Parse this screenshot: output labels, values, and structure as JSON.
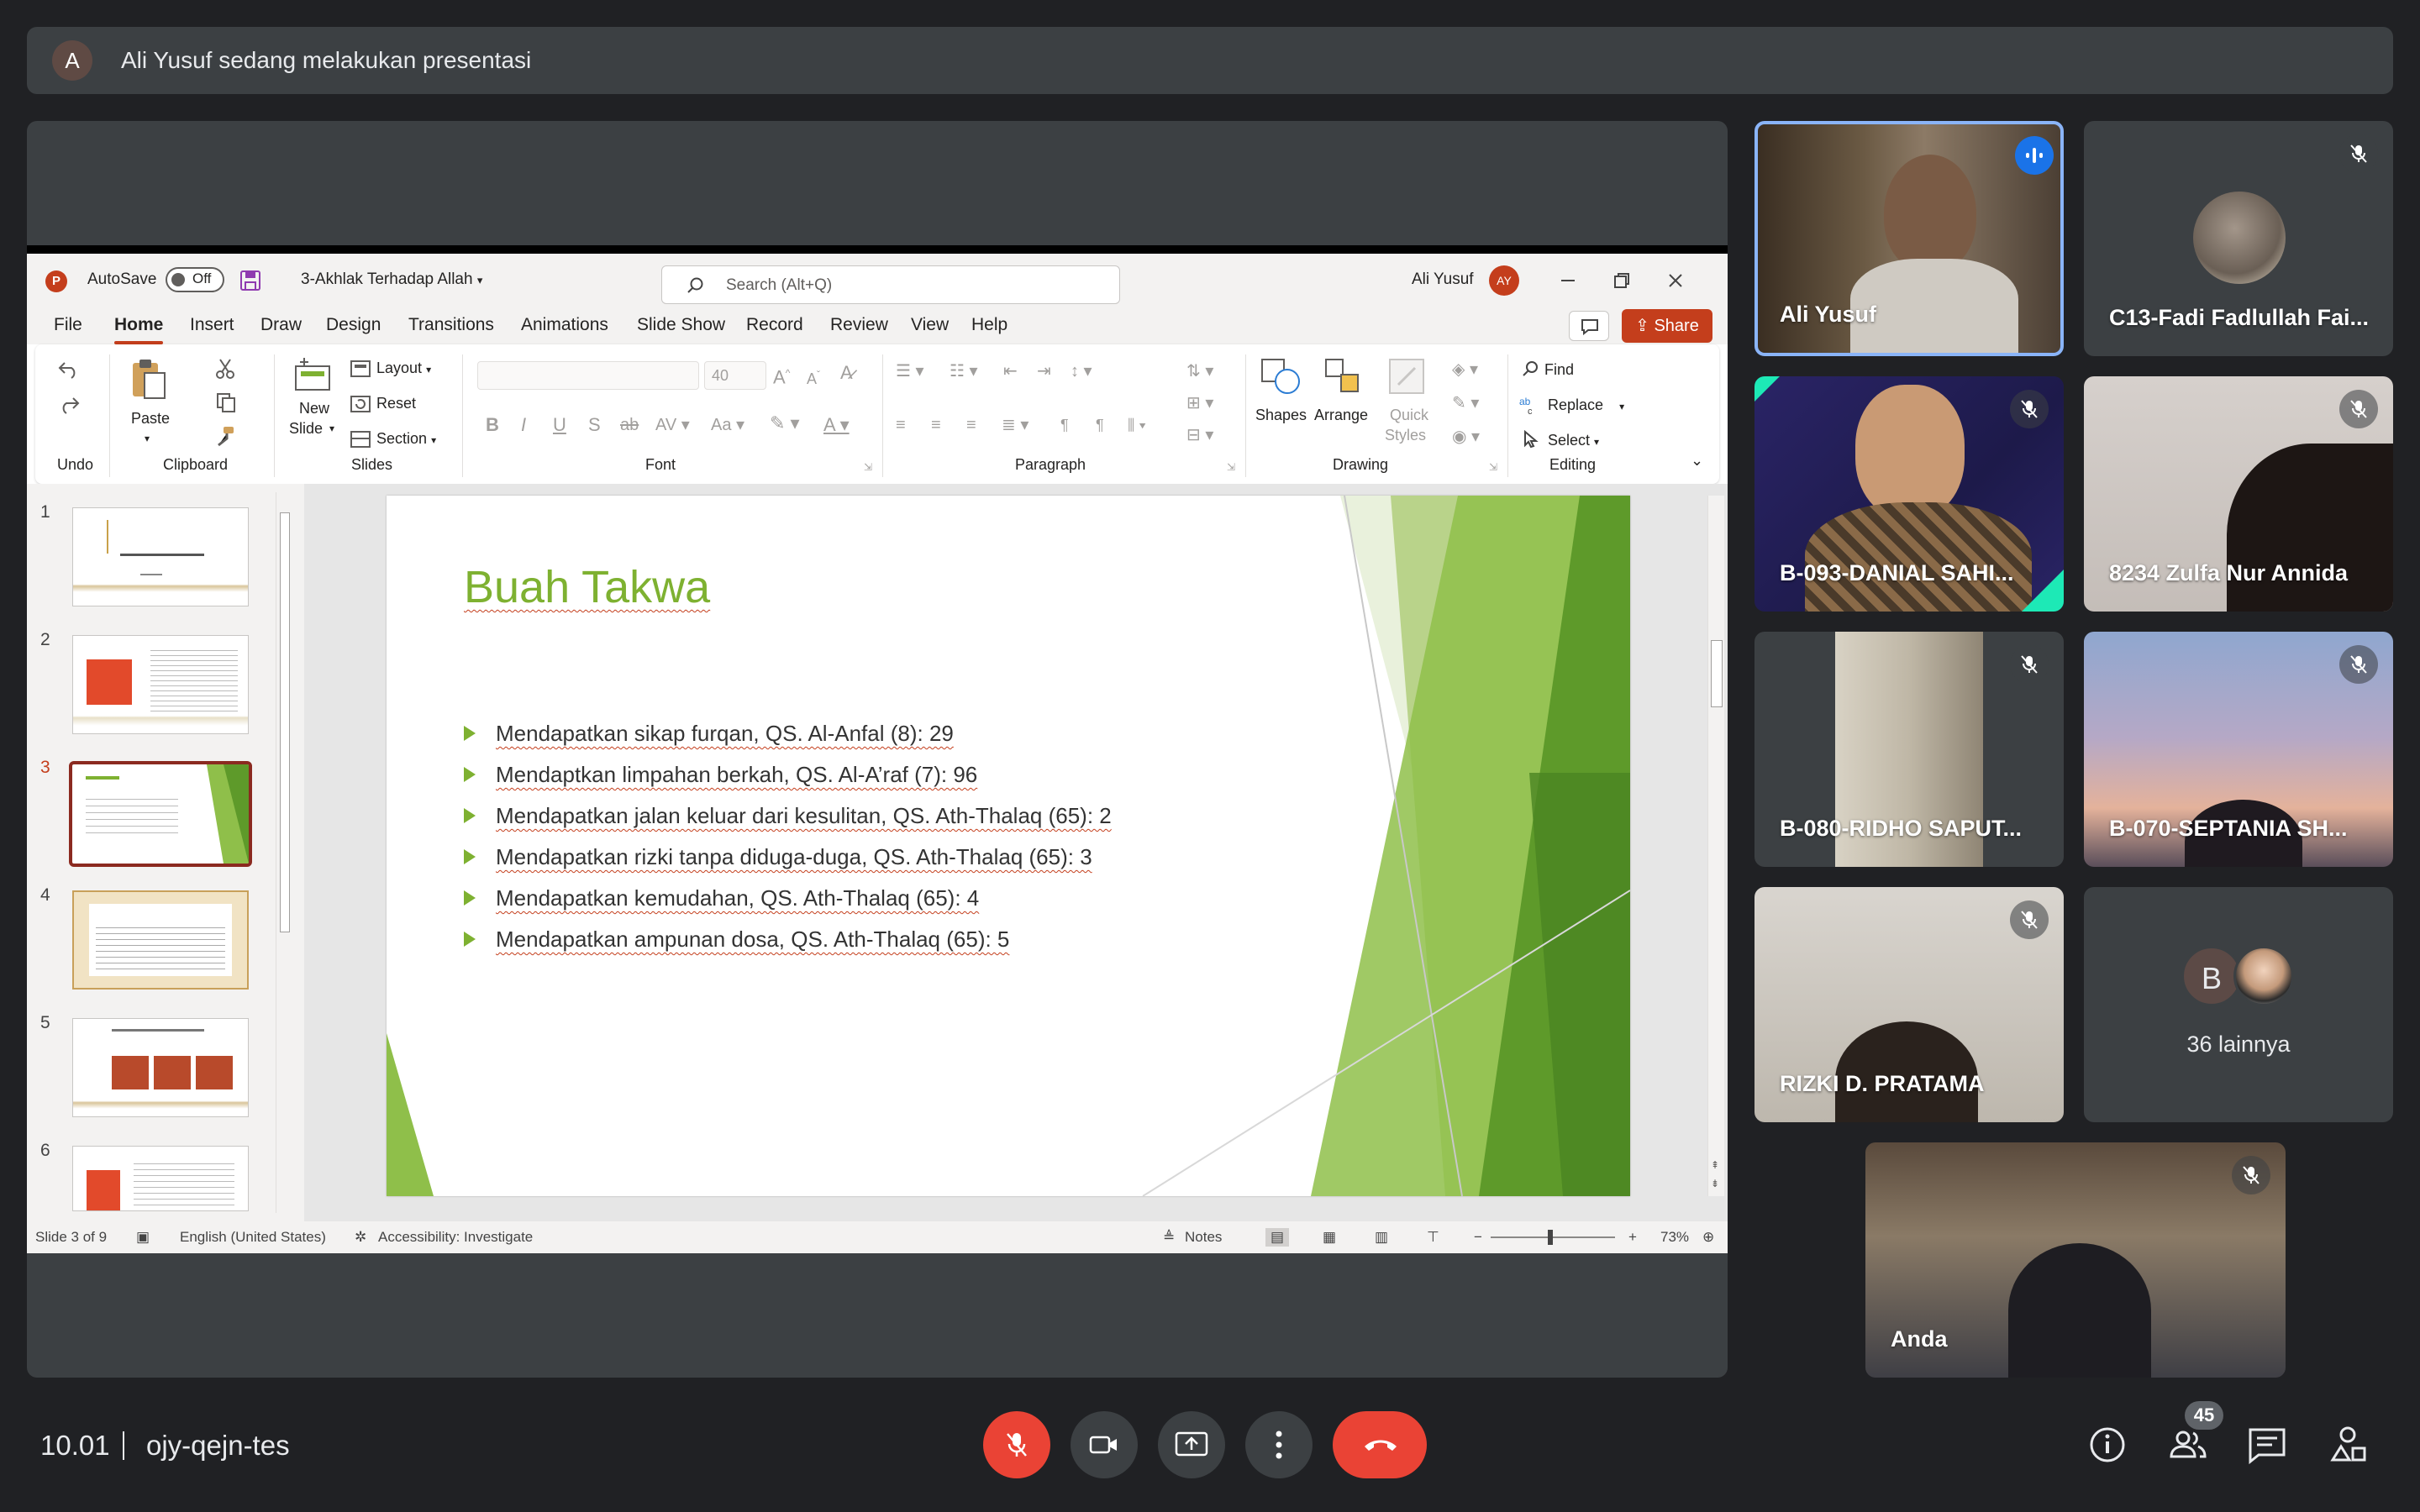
{
  "banner": {
    "avatar_letter": "A",
    "text": "Ali Yusuf sedang melakukan presentasi"
  },
  "ppt": {
    "autosave_label": "AutoSave",
    "autosave_state": "Off",
    "file_name": "3-Akhlak Terhadap Allah",
    "search_placeholder": "Search (Alt+Q)",
    "user_name": "Ali Yusuf",
    "user_initials": "AY",
    "tabs": [
      "File",
      "Home",
      "Insert",
      "Draw",
      "Design",
      "Transitions",
      "Animations",
      "Slide Show",
      "Record",
      "Review",
      "View",
      "Help"
    ],
    "active_tab": "Home",
    "share_label": "Share",
    "ribbon": {
      "groups": {
        "undo": "Undo",
        "clipboard": "Clipboard",
        "slides": "Slides",
        "font": "Font",
        "paragraph": "Paragraph",
        "drawing": "Drawing",
        "editing": "Editing"
      },
      "paste": "Paste",
      "new_slide_1": "New",
      "new_slide_2": "Slide",
      "layout": "Layout",
      "reset": "Reset",
      "section": "Section",
      "font_size": "40",
      "shapes": "Shapes",
      "arrange": "Arrange",
      "quick_styles_1": "Quick",
      "quick_styles_2": "Styles",
      "find": "Find",
      "replace": "Replace",
      "select": "Select"
    },
    "thumbnails": [
      "1",
      "2",
      "3",
      "4",
      "5",
      "6"
    ],
    "selected_slide": "3",
    "slide": {
      "title": "Buah Takwa",
      "bullets": [
        "Mendapatkan sikap furqan, QS. Al-Anfal (8): 29",
        "Mendaptkan limpahan berkah, QS. Al-A’raf (7): 96",
        "Mendapatkan jalan keluar dari kesulitan, QS. Ath-Thalaq (65): 2",
        "Mendapatkan rizki tanpa diduga-duga, QS. Ath-Thalaq (65): 3",
        "Mendapatkan kemudahan, QS. Ath-Thalaq (65): 4",
        "Mendapatkan ampunan dosa, QS. Ath-Thalaq (65): 5"
      ]
    },
    "status": {
      "slide_counter": "Slide 3 of 9",
      "language": "English (United States)",
      "accessibility": "Accessibility: Investigate",
      "notes": "Notes",
      "zoom": "73%"
    }
  },
  "participants": [
    {
      "name": "Ali Yusuf",
      "speaking": true
    },
    {
      "name": "C13-Fadi Fadlullah Fai..."
    },
    {
      "name": "B-093-DANIAL SAHI..."
    },
    {
      "name": "8234 Zulfa Nur Annida"
    },
    {
      "name": "B-080-RIDHO SAPUT..."
    },
    {
      "name": "B-070-SEPTANIA SH..."
    },
    {
      "name": "RIZKI D. PRATAMA"
    },
    {
      "name": "Anda"
    }
  ],
  "others_tile": {
    "avatar_letter": "B",
    "label": "36 lainnya"
  },
  "bottom": {
    "time": "10.01",
    "meeting_code": "ojy-qejn-tes",
    "participant_count": "45"
  },
  "colors": {
    "ppt_accent": "#c43e1c",
    "slide_green": "#7eb131",
    "end_call_red": "#ea4335",
    "meet_bg": "#202124"
  }
}
